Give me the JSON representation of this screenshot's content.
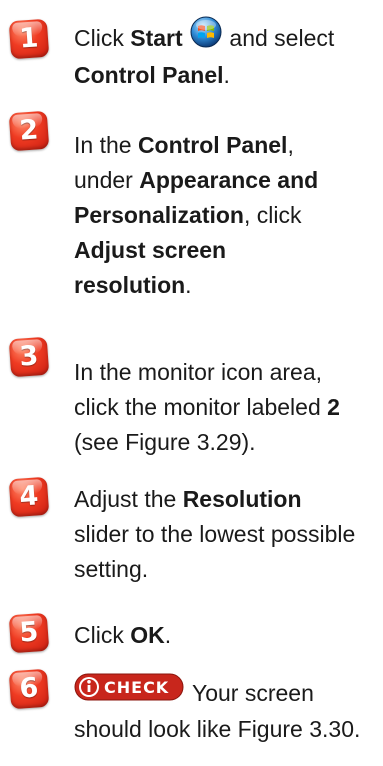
{
  "steps": [
    {
      "number": "1",
      "parts": [
        "Click ",
        "Start",
        " and select ",
        "Control Panel",
        "."
      ]
    },
    {
      "number": "2",
      "parts": [
        "In the ",
        "Control Panel",
        ",",
        "under ",
        "Appearance and",
        "Personalization",
        ", click",
        "Adjust screen",
        "resolution",
        "."
      ]
    },
    {
      "number": "3",
      "lines": [
        "In the monitor icon area,",
        "click the monitor labeled ",
        "2",
        "(see Figure 3.29)."
      ]
    },
    {
      "number": "4",
      "parts": [
        "Adjust the ",
        "Resolution",
        "slider to the lowest possible",
        "setting."
      ]
    },
    {
      "number": "5",
      "parts": [
        "Click ",
        "OK",
        "."
      ]
    },
    {
      "number": "6",
      "check_label": "CHECK",
      "parts": [
        " Your screen",
        "should look like Figure 3.30."
      ]
    }
  ],
  "icons": {
    "start": "windows-start-orb-icon",
    "check": "check-badge-icon"
  },
  "colors": {
    "badge_red": "#e5321d",
    "text": "#1a1a1a",
    "check_bg": "#c8261c"
  }
}
